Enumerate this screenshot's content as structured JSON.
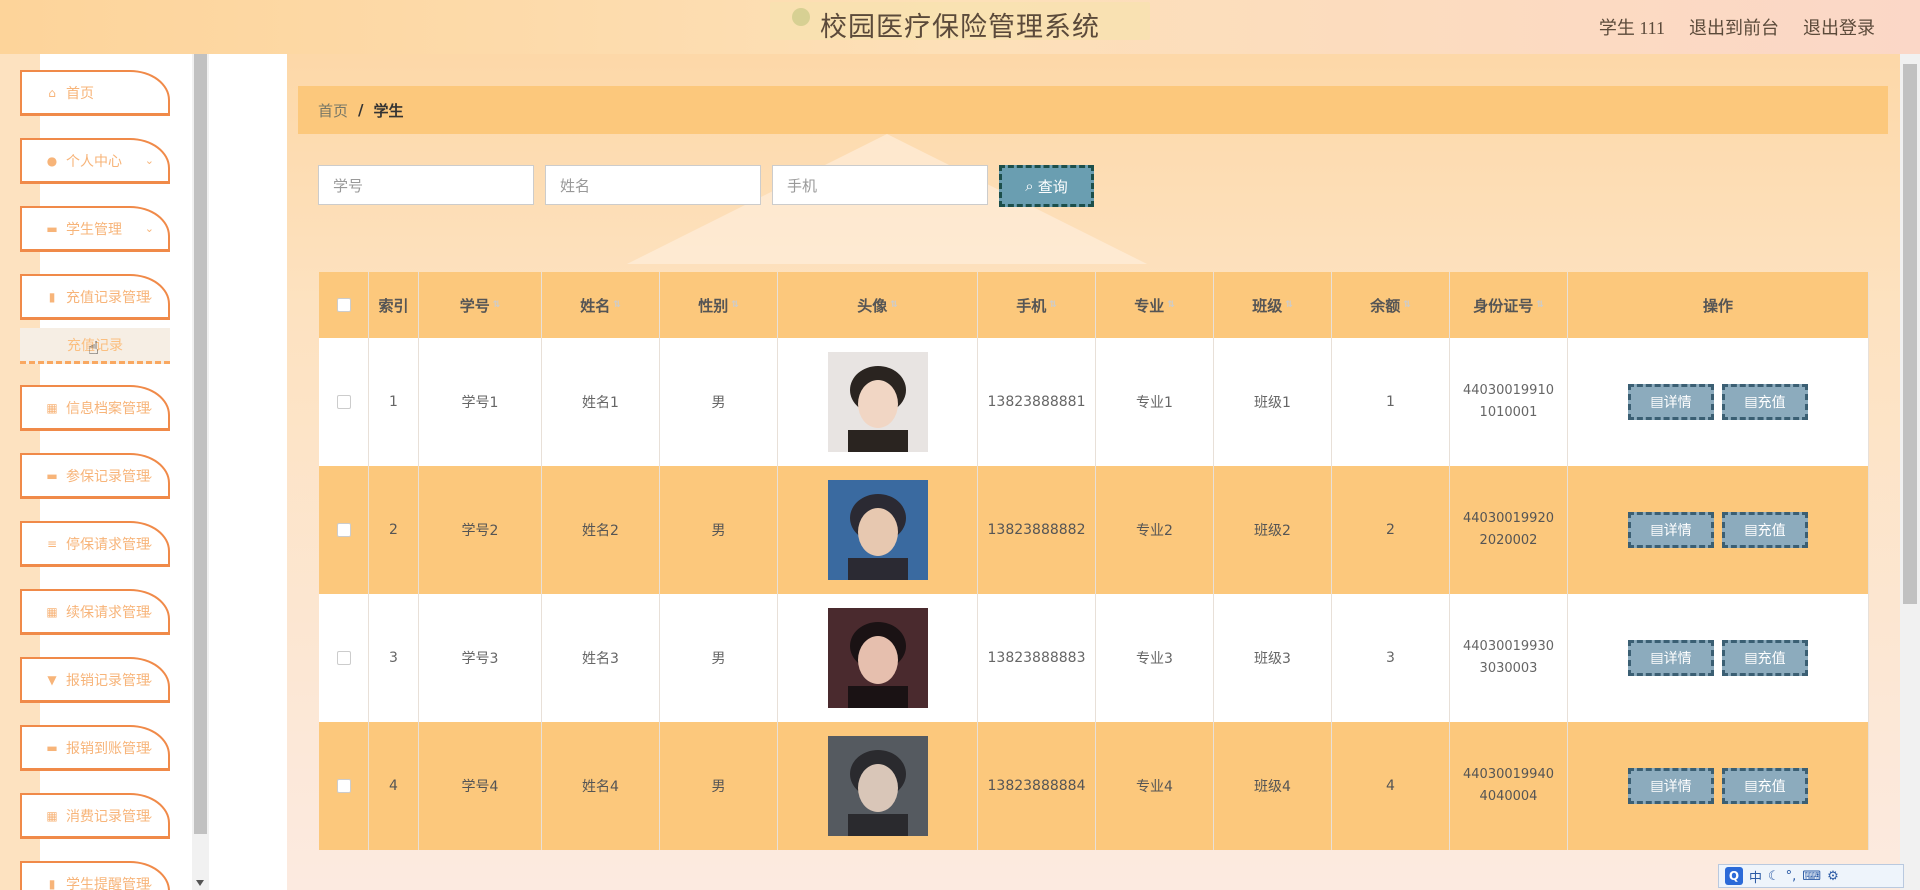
{
  "header": {
    "title": "校园医疗保险管理系统",
    "user": "学生 111",
    "front_link": "退出到前台",
    "logout_link": "退出登录"
  },
  "sidebar": {
    "items": [
      {
        "label": "首页",
        "icon": "home-icon"
      },
      {
        "label": "个人中心",
        "icon": "user-icon"
      },
      {
        "label": "学生管理",
        "icon": "briefcase-icon"
      },
      {
        "label": "充值记录管理",
        "icon": "file-icon"
      },
      {
        "label": "信息档案管理",
        "icon": "grid-icon"
      },
      {
        "label": "参保记录管理",
        "icon": "chat-icon"
      },
      {
        "label": "停保请求管理",
        "icon": "list-icon"
      },
      {
        "label": "续保请求管理",
        "icon": "grid-icon"
      },
      {
        "label": "报销记录管理",
        "icon": "bookmark-icon"
      },
      {
        "label": "报销到账管理",
        "icon": "printer-icon"
      },
      {
        "label": "消费记录管理",
        "icon": "grid-icon"
      },
      {
        "label": "学生提醒管理",
        "icon": "chart-icon"
      }
    ],
    "sub_item": "充值记录"
  },
  "breadcrumb": {
    "home": "首页",
    "sep": "/",
    "current": "学生"
  },
  "search": {
    "id_placeholder": "学号",
    "name_placeholder": "姓名",
    "phone_placeholder": "手机",
    "button_label": "查询"
  },
  "table": {
    "headers": [
      "索引",
      "学号",
      "姓名",
      "性别",
      "头像",
      "手机",
      "专业",
      "班级",
      "余额",
      "身份证号",
      "操作"
    ],
    "rows": [
      {
        "index": "1",
        "sid": "学号1",
        "name": "姓名1",
        "gender": "男",
        "phone": "13823888881",
        "major": "专业1",
        "cls": "班级1",
        "balance": "1",
        "idcard": "440300199101010001"
      },
      {
        "index": "2",
        "sid": "学号2",
        "name": "姓名2",
        "gender": "男",
        "phone": "13823888882",
        "major": "专业2",
        "cls": "班级2",
        "balance": "2",
        "idcard": "440300199202020002"
      },
      {
        "index": "3",
        "sid": "学号3",
        "name": "姓名3",
        "gender": "男",
        "phone": "13823888883",
        "major": "专业3",
        "cls": "班级3",
        "balance": "3",
        "idcard": "440300199303030003"
      },
      {
        "index": "4",
        "sid": "学号4",
        "name": "姓名4",
        "gender": "男",
        "phone": "13823888884",
        "major": "专业4",
        "cls": "班级4",
        "balance": "4",
        "idcard": "440300199404040004"
      }
    ],
    "detail_label": "详情",
    "recharge_label": "充值"
  },
  "ime": {
    "lang": "中",
    "q": "Q"
  }
}
